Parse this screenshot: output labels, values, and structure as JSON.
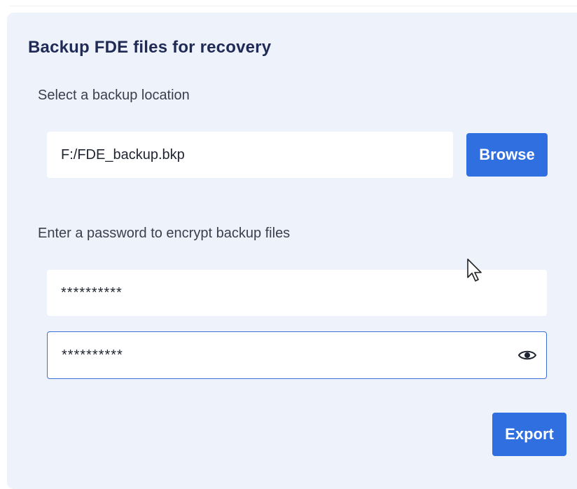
{
  "dialog": {
    "title": "Backup FDE files for recovery"
  },
  "location": {
    "label": "Select a backup location",
    "value": "F:/FDE_backup.bkp",
    "browse_label": "Browse"
  },
  "password": {
    "label": "Enter a password to encrypt backup files",
    "value": "**********",
    "confirm_value": "**********",
    "reveal_icon": "eye-icon"
  },
  "actions": {
    "export_label": "Export"
  },
  "colors": {
    "card_background": "#eef2fb",
    "title": "#1f2a55",
    "primary_button": "#2f6fe0",
    "focused_border": "#3a6fd8"
  }
}
